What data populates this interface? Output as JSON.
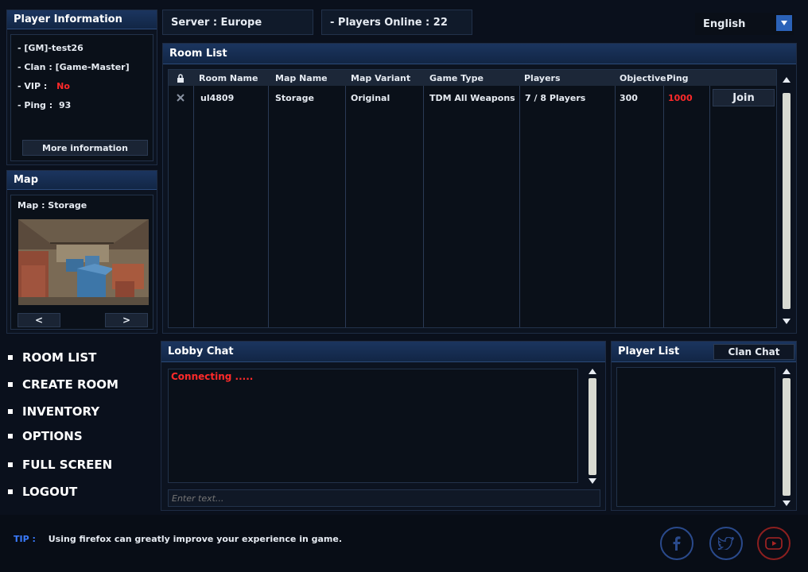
{
  "player_info": {
    "title": "Player Information",
    "name": "- [GM]-test26",
    "clan_label": "- Clan :",
    "clan_value": "[Game-Master]",
    "vip_label": "- VIP :",
    "vip_value": "No",
    "ping_label": "- Ping :",
    "ping_value": "93",
    "more_button": "More information"
  },
  "map_panel": {
    "title": "Map",
    "map_label": "Map : Storage",
    "prev_button": "<",
    "next_button": ">"
  },
  "top_bar": {
    "server": "Server : Europe",
    "players_online": "- Players Online : 22",
    "language": "English",
    "language_dropdown_icon": "chevron-down-icon"
  },
  "room_list": {
    "title": "Room List",
    "columns": [
      "Room Name",
      "Map Name",
      "Map Variant",
      "Game Type",
      "Players",
      "Objective",
      "Ping"
    ],
    "rows": [
      {
        "room_name": "ul4809",
        "map_name": "Storage",
        "map_variant": "Original",
        "game_type": "TDM All Weapons",
        "players": "7 / 8 Players",
        "objective": "300",
        "ping": "1000",
        "join_label": "Join"
      }
    ]
  },
  "menu": {
    "items": [
      "ROOM LIST",
      "CREATE ROOM",
      "INVENTORY",
      "OPTIONS",
      "FULL SCREEN",
      "LOGOUT"
    ]
  },
  "lobby_chat": {
    "title": "Lobby Chat",
    "status": "Connecting .....",
    "input_placeholder": "Enter text..."
  },
  "player_list": {
    "title": "Player List",
    "clan_chat_tab": "Clan Chat"
  },
  "footer": {
    "tip_label": "TIP :",
    "tip_text": "Using firefox can greatly improve your experience in game.",
    "social": [
      "facebook-icon",
      "twitter-icon",
      "youtube-icon"
    ]
  },
  "colors": {
    "accent_blue": "#1b355f",
    "alert_red": "#ff2a2a",
    "clan_orange": "#ff9a1a",
    "tip_blue": "#3a7bff"
  }
}
